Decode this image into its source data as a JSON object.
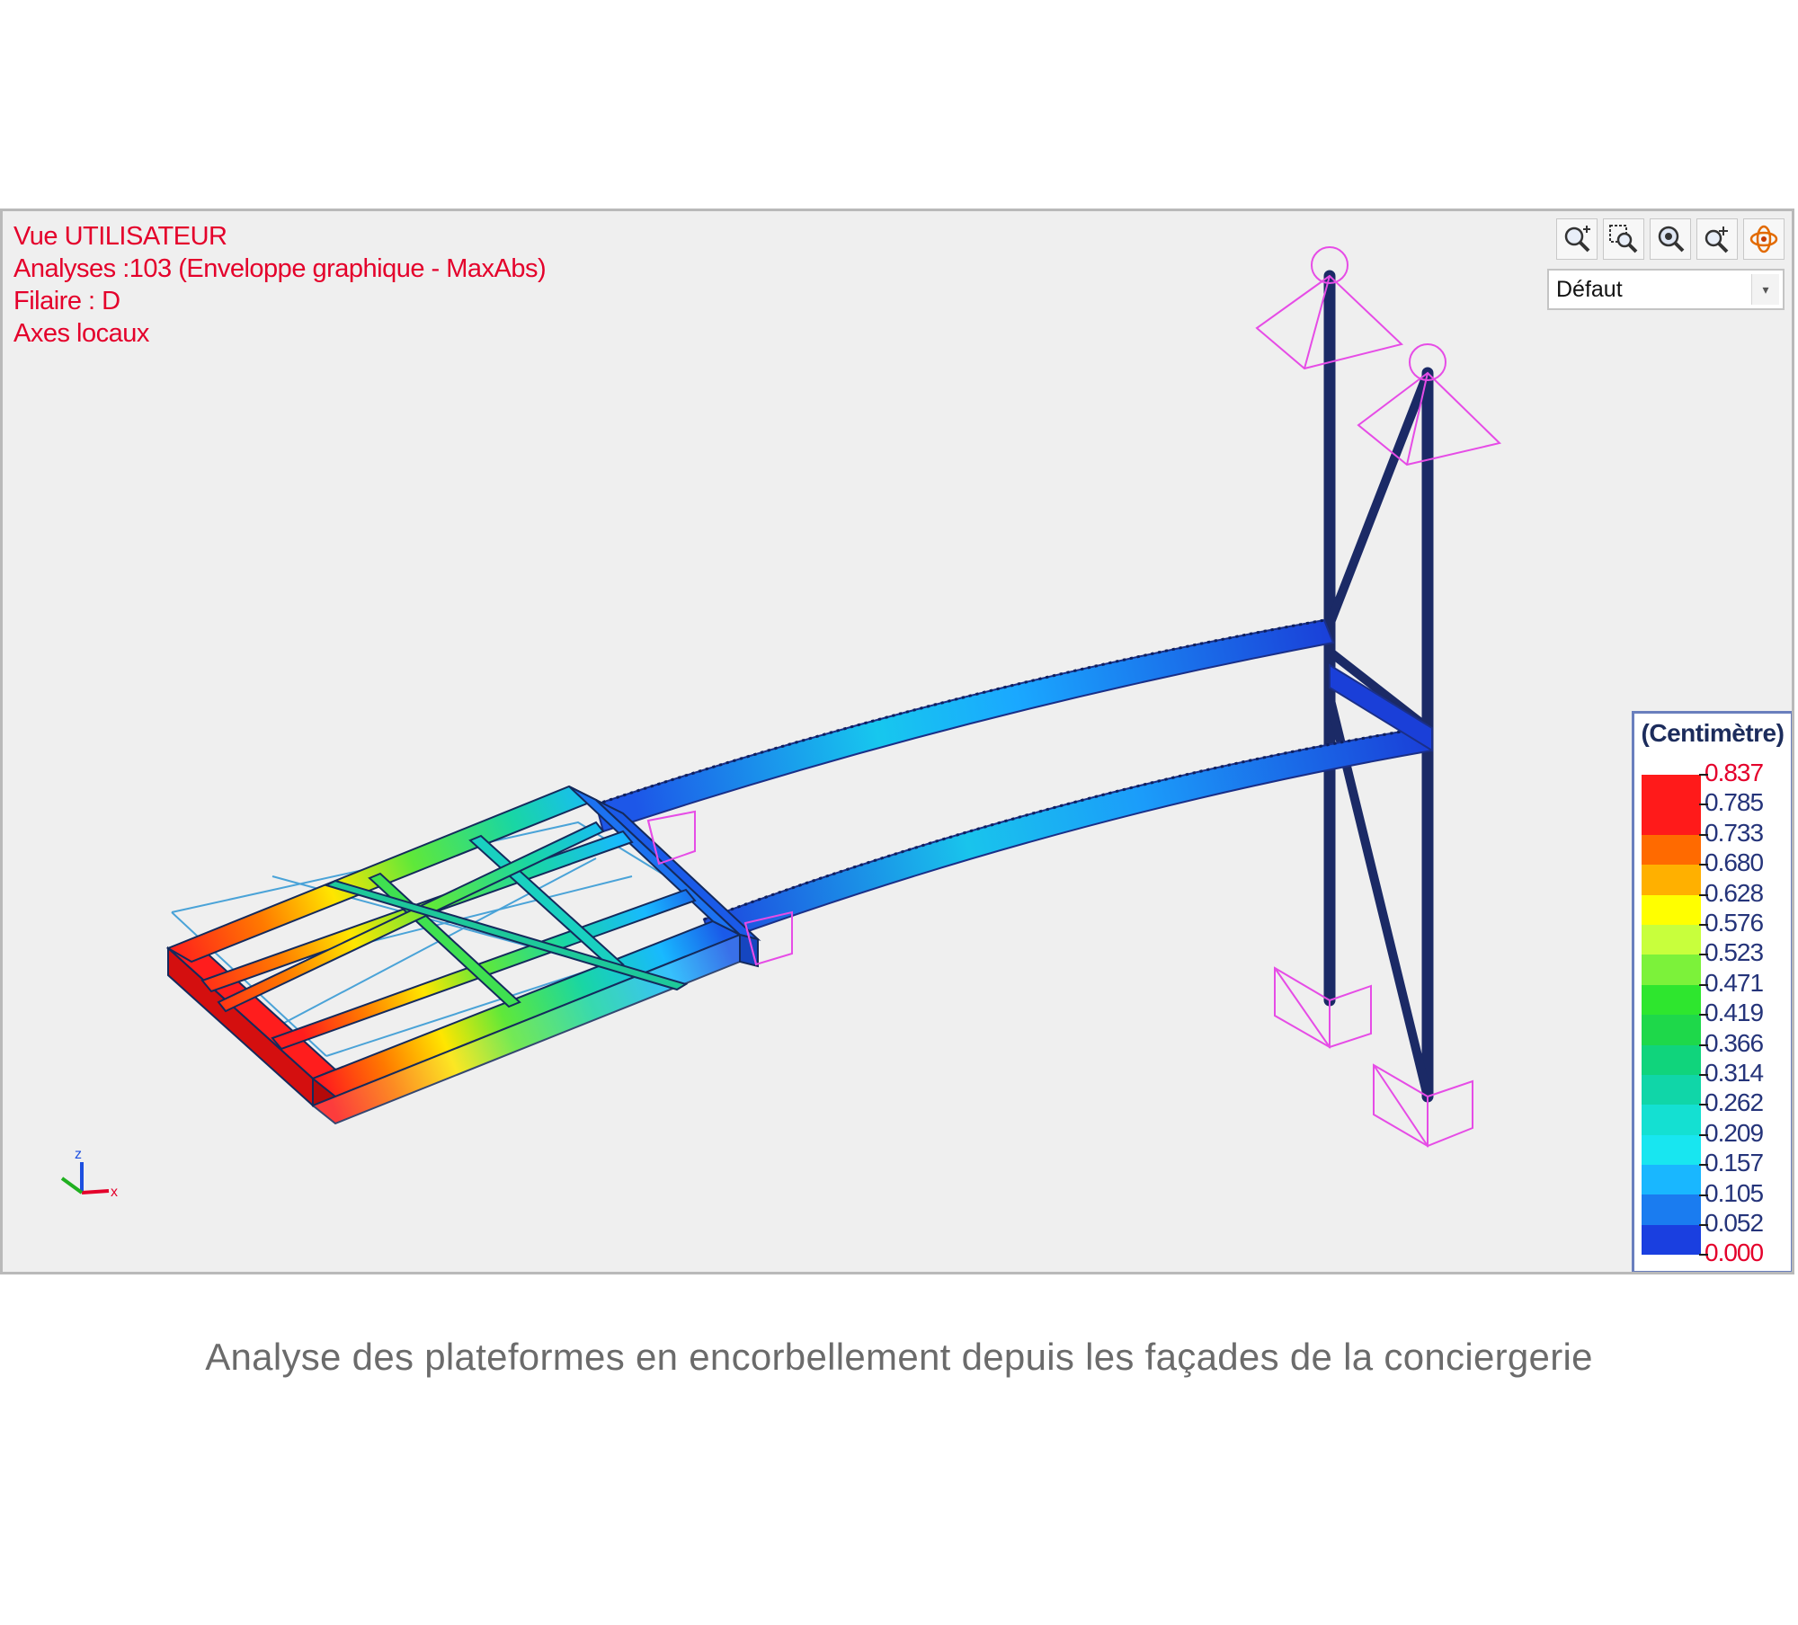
{
  "viewport": {
    "info_lines": [
      "Vue UTILISATEUR",
      "Analyses :103 (Enveloppe graphique - MaxAbs)",
      "Filaire : D",
      "Axes locaux"
    ],
    "toolbar_icons": [
      "zoom-in-icon",
      "zoom-window-icon",
      "zoom-extents-icon",
      "zoom-dynamic-icon",
      "rotate-view-icon"
    ],
    "view_select": {
      "value": "Défaut"
    },
    "axes_triad": {
      "labels": [
        "z",
        "x"
      ]
    }
  },
  "legend": {
    "unit": "(Centimètre)",
    "values": [
      "0.837",
      "0.785",
      "0.733",
      "0.680",
      "0.628",
      "0.576",
      "0.523",
      "0.471",
      "0.419",
      "0.366",
      "0.314",
      "0.262",
      "0.209",
      "0.157",
      "0.105",
      "0.052",
      "0.000"
    ],
    "colors": [
      "#ff1a1a",
      "#ff1a1a",
      "#ff6a00",
      "#ffb000",
      "#ffff00",
      "#c8ff3c",
      "#7cf23a",
      "#2ee62e",
      "#1ed84a",
      "#10d47c",
      "#10d6a8",
      "#14e0d2",
      "#18e6f0",
      "#19b7ff",
      "#1a7cf0",
      "#1a3fe0"
    ],
    "extreme_color": "#e4002b"
  },
  "caption": "Analyse des plateformes en encorbellement depuis les façades de la conciergerie"
}
